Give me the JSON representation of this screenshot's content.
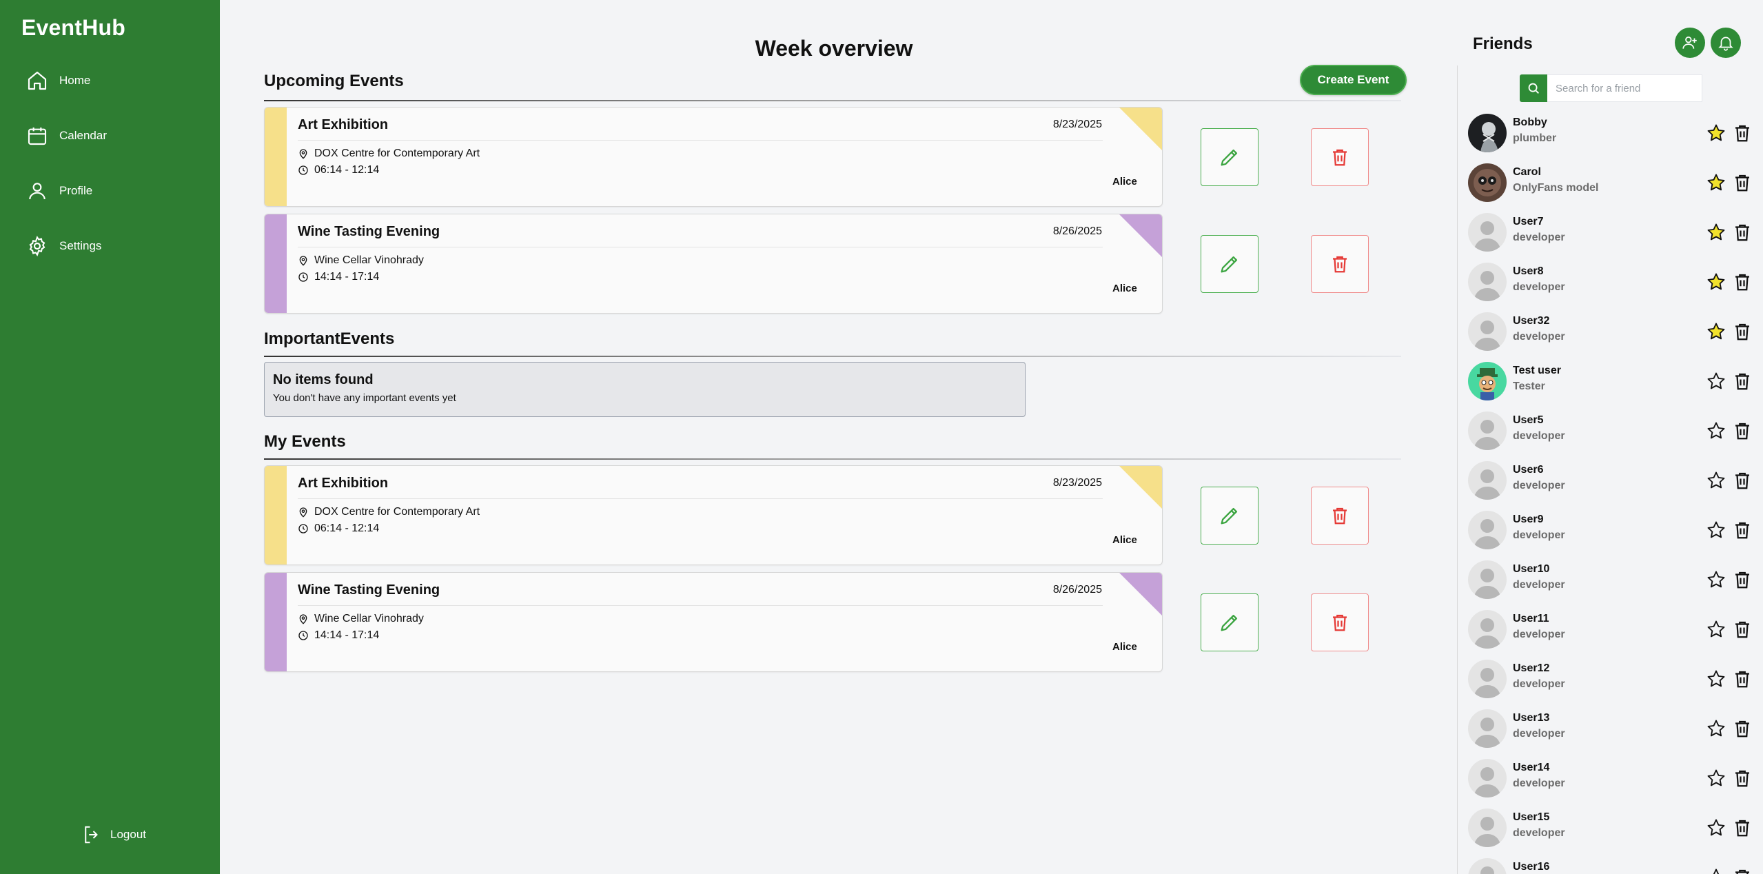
{
  "app": {
    "brand": "EventHub",
    "logout_label": "Logout"
  },
  "sidebar": {
    "items": [
      {
        "label": "Home",
        "icon": "home-icon"
      },
      {
        "label": "Calendar",
        "icon": "calendar-icon"
      },
      {
        "label": "Profile",
        "icon": "user-icon"
      },
      {
        "label": "Settings",
        "icon": "gear-icon"
      }
    ]
  },
  "main": {
    "title": "Week overview",
    "create_label": "Create Event",
    "sections": {
      "upcoming": "Upcoming Events",
      "important": "ImportantEvents",
      "mine": "My Events"
    },
    "upcoming_events": [
      {
        "title": "Art Exhibition",
        "date": "8/23/2025",
        "location": "DOX Centre for Contemporary Art",
        "time": "06:14 - 12:14",
        "owner": "Alice",
        "color": "#f6e08a"
      },
      {
        "title": "Wine Tasting Evening",
        "date": "8/26/2025",
        "location": "Wine Cellar Vinohrady",
        "time": "14:14 - 17:14",
        "owner": "Alice",
        "color": "#c5a1d8"
      }
    ],
    "important_empty": {
      "title": "No items found",
      "subtitle": "You don't have any important events yet"
    },
    "my_events": [
      {
        "title": "Art Exhibition",
        "date": "8/23/2025",
        "location": "DOX Centre for Contemporary Art",
        "time": "06:14 - 12:14",
        "owner": "Alice",
        "color": "#f6e08a"
      },
      {
        "title": "Wine Tasting Evening",
        "date": "8/26/2025",
        "location": "Wine Cellar Vinohrady",
        "time": "14:14 - 17:14",
        "owner": "Alice",
        "color": "#c5a1d8"
      }
    ]
  },
  "friends": {
    "title": "Friends",
    "search_placeholder": "Search for a friend",
    "list": [
      {
        "name": "Bobby",
        "role": "plumber",
        "favorite": true,
        "avatar": "photo-dark"
      },
      {
        "name": "Carol",
        "role": "OnlyFans model",
        "favorite": true,
        "avatar": "photo-brown"
      },
      {
        "name": "User7",
        "role": "developer",
        "favorite": true,
        "avatar": "default"
      },
      {
        "name": "User8",
        "role": "developer",
        "favorite": true,
        "avatar": "default"
      },
      {
        "name": "User32",
        "role": "developer",
        "favorite": true,
        "avatar": "default"
      },
      {
        "name": "Test user",
        "role": "Tester",
        "favorite": false,
        "avatar": "cartoon"
      },
      {
        "name": "User5",
        "role": "developer",
        "favorite": false,
        "avatar": "default"
      },
      {
        "name": "User6",
        "role": "developer",
        "favorite": false,
        "avatar": "default"
      },
      {
        "name": "User9",
        "role": "developer",
        "favorite": false,
        "avatar": "default"
      },
      {
        "name": "User10",
        "role": "developer",
        "favorite": false,
        "avatar": "default"
      },
      {
        "name": "User11",
        "role": "developer",
        "favorite": false,
        "avatar": "default"
      },
      {
        "name": "User12",
        "role": "developer",
        "favorite": false,
        "avatar": "default"
      },
      {
        "name": "User13",
        "role": "developer",
        "favorite": false,
        "avatar": "default"
      },
      {
        "name": "User14",
        "role": "developer",
        "favorite": false,
        "avatar": "default"
      },
      {
        "name": "User15",
        "role": "developer",
        "favorite": false,
        "avatar": "default"
      },
      {
        "name": "User16",
        "role": "",
        "favorite": false,
        "avatar": "default"
      }
    ]
  },
  "colors": {
    "brand_green": "#2e7d32",
    "favorite_star": "#f2e22b",
    "delete_red": "#e53935"
  }
}
